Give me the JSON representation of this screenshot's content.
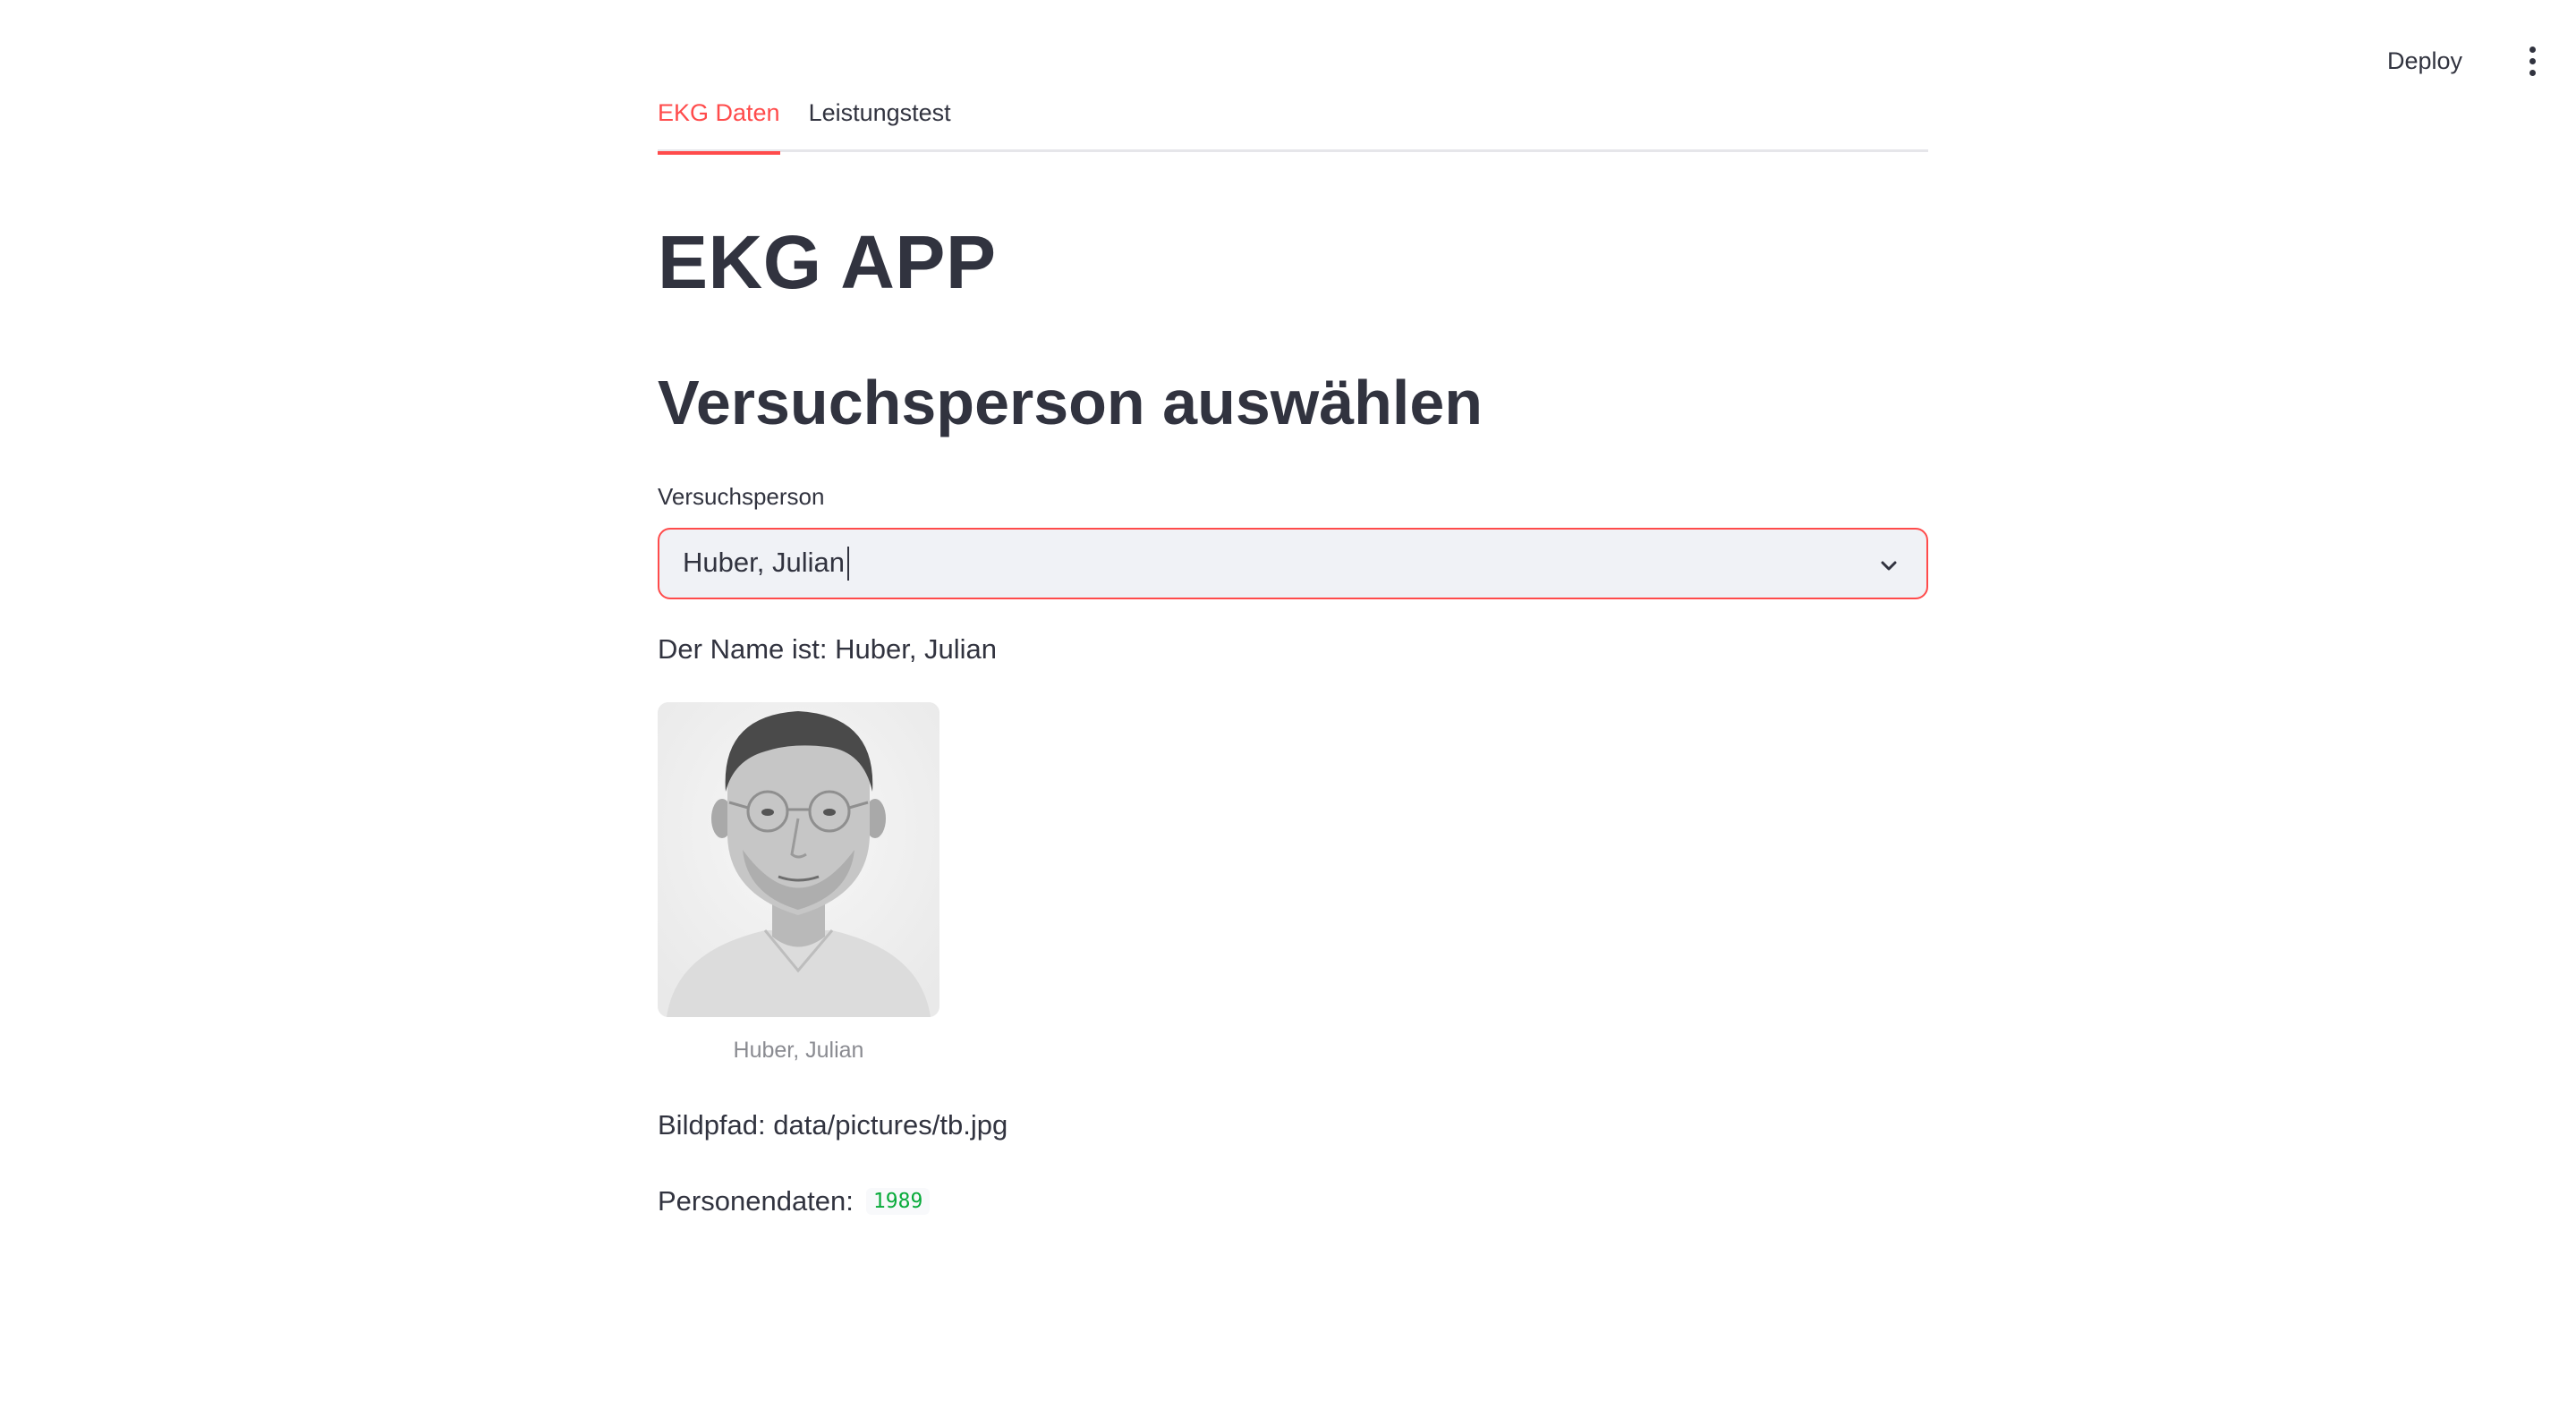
{
  "header": {
    "deploy_label": "Deploy",
    "menu_icon": "vertical-ellipsis-icon"
  },
  "tabs": [
    {
      "label": "EKG Daten",
      "active": true
    },
    {
      "label": "Leistungstest",
      "active": false
    }
  ],
  "page": {
    "title": "EKG APP",
    "subtitle": "Versuchsperson auswählen"
  },
  "select": {
    "label": "Versuchsperson",
    "value": "Huber, Julian",
    "icon": "chevron-down-icon"
  },
  "info": {
    "name_line": "Der Name ist: Huber, Julian",
    "image_caption": "Huber, Julian",
    "path_line": "Bildpfad: data/pictures/tb.jpg",
    "persons_label": "Personendaten:",
    "persons_value": "1989"
  },
  "colors": {
    "accent": "#ff4b4b",
    "text": "#31333f",
    "code_green": "#09ab3b",
    "input_bg": "#f0f2f6"
  }
}
